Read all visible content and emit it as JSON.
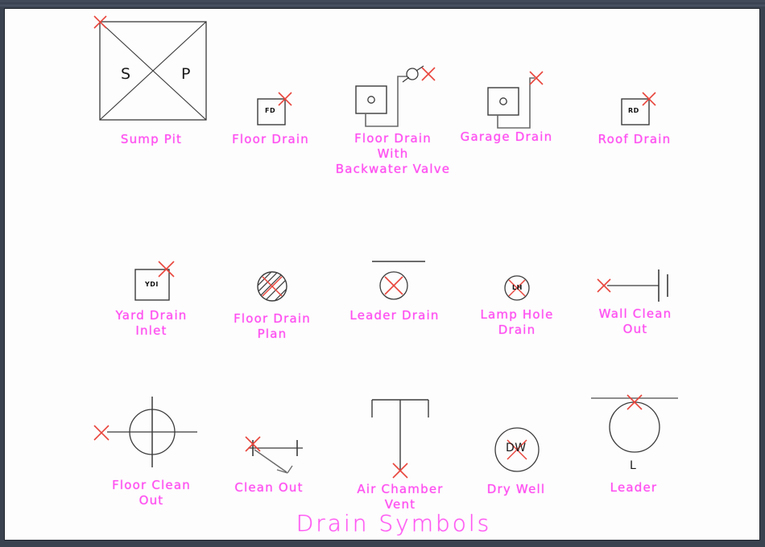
{
  "window": {
    "title": "Drain Symbols",
    "background_color": "#2f3640",
    "canvas_color": "#fdfdfd"
  },
  "drawing": {
    "title": "Drain  Symbols",
    "label_color": "#ff4ff0",
    "line_color": "#3b3b3b",
    "marker_color": "#e8453c",
    "rows": [
      {
        "symbols": [
          {
            "caption": "Sump  Pit",
            "inner_text": "S      P",
            "marker": "x-cross"
          },
          {
            "caption": "Floor  Drain",
            "inner_text": "FD",
            "marker": "x-cross"
          },
          {
            "caption": "Floor  Drain\nWith\nBackwater  Valve",
            "inner_text": "",
            "marker": "x-cross"
          },
          {
            "caption": "Garage  Drain",
            "inner_text": "",
            "marker": "x-cross"
          },
          {
            "caption": "Roof  Drain",
            "inner_text": "RD",
            "marker": "x-cross"
          }
        ]
      },
      {
        "symbols": [
          {
            "caption": "Yard  Drain\nInlet",
            "inner_text": "YDI",
            "marker": "x-cross"
          },
          {
            "caption": "Floor  Drain\nPlan",
            "inner_text": "",
            "marker": "x-cross"
          },
          {
            "caption": "Leader  Drain",
            "inner_text": "",
            "marker": "x-cross"
          },
          {
            "caption": "Lamp  Hole\nDrain",
            "inner_text": "LH",
            "marker": "x-cross"
          },
          {
            "caption": "Wall  Clean\nOut",
            "inner_text": "",
            "marker": "x-cross"
          }
        ]
      },
      {
        "symbols": [
          {
            "caption": "Floor  Clean\nOut",
            "inner_text": "",
            "marker": "x-cross"
          },
          {
            "caption": "Clean  Out",
            "inner_text": "",
            "marker": "x-cross"
          },
          {
            "caption": "Air  Chamber\nVent",
            "inner_text": "",
            "marker": "x-cross"
          },
          {
            "caption": "Dry  Well",
            "inner_text": "DW",
            "marker": "x-cross"
          },
          {
            "caption": "Leader",
            "inner_text": "L",
            "marker": "x-cross"
          }
        ]
      }
    ]
  }
}
